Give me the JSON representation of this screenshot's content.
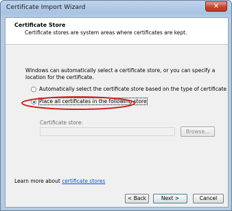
{
  "window": {
    "title": "Certificate Import Wizard",
    "close_symbol": "✕"
  },
  "header": {
    "title": "Certificate Store",
    "subtitle": "Certificate stores are system areas where certificates are kept."
  },
  "body": {
    "description": "Windows can automatically select a certificate store, or you can specify a location for the certificate.",
    "options": [
      {
        "label": "Automatically select the certificate store based on the type of certificate",
        "checked": false
      },
      {
        "label": "Place all certificates in the following store",
        "checked": true
      }
    ],
    "store_label": "Certificate store:",
    "store_value": "",
    "browse_label": "Browse...",
    "learn_prefix": "Learn more about ",
    "learn_link": "certificate stores"
  },
  "buttons": {
    "back": "< Back",
    "next": "Next >",
    "cancel": "Cancel"
  },
  "colors": {
    "highlight": "#d2201f",
    "link": "#0a58c8",
    "radio_fill": "#1e5ba8"
  }
}
